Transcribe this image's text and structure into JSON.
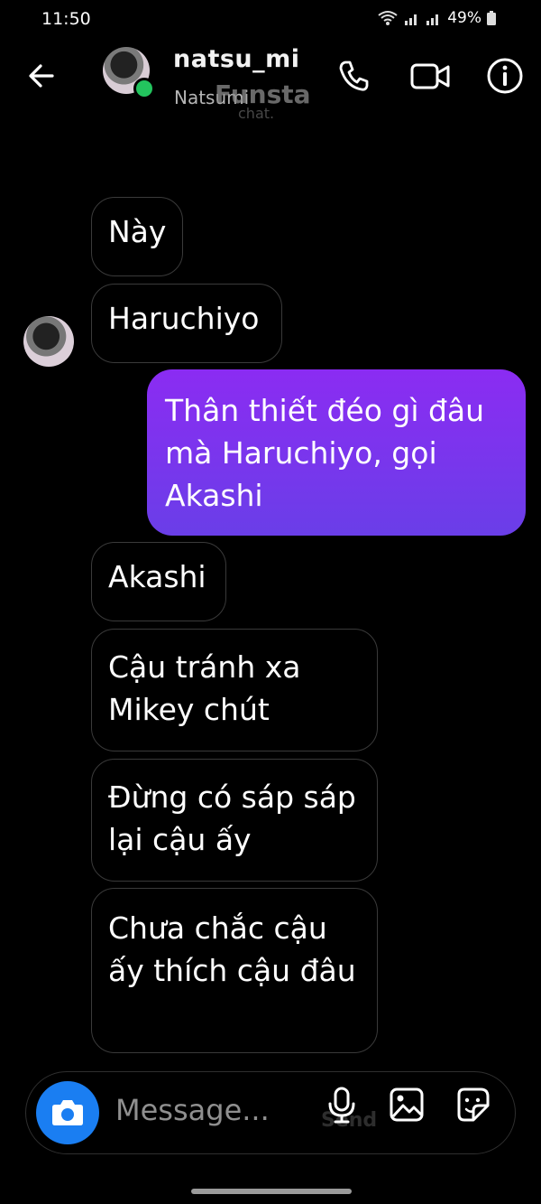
{
  "status_bar": {
    "time": "11:50",
    "battery": "49%"
  },
  "header": {
    "username": "natsu_mi",
    "display_name": "Natsumi",
    "watermark": "Funsta",
    "watermark_sub": "chat."
  },
  "messages": [
    {
      "side": "in",
      "text": "Này"
    },
    {
      "side": "in",
      "text": "Haruchiyo"
    },
    {
      "side": "out",
      "text": "Thân thiết đéo gì đâu mà Haruchiyo, gọi Akashi"
    },
    {
      "side": "in",
      "text": "Akashi"
    },
    {
      "side": "in",
      "text": "Cậu tránh xa Mikey chút"
    },
    {
      "side": "in",
      "text": "Đừng có sáp sáp lại cậu ấy"
    },
    {
      "side": "in",
      "text": "Chưa chắc cậu ấy thích cậu đâu"
    }
  ],
  "composer": {
    "placeholder": "Message...",
    "ghost_text": "Send"
  },
  "icons": {
    "back": "arrow-left-icon",
    "call": "phone-icon",
    "video": "video-camera-icon",
    "info": "info-icon",
    "camera": "camera-icon",
    "mic": "microphone-icon",
    "gallery": "image-icon",
    "sticker": "sticker-icon"
  },
  "colors": {
    "background": "#000000",
    "outgoing_bubble": "#7b35ee",
    "camera_button": "#1a7ef2",
    "online": "#23c45e"
  }
}
